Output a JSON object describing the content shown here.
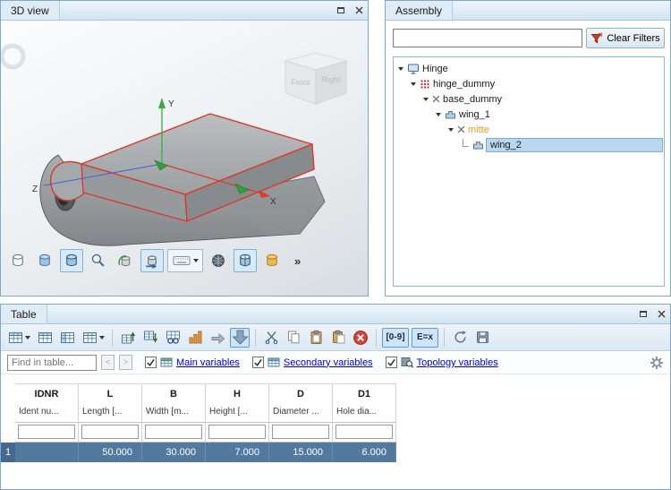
{
  "view3d": {
    "tab": "3D view",
    "axes": {
      "x": "X",
      "y": "Y",
      "z": "Z"
    },
    "cube": {
      "front": "Front",
      "right": "Right"
    },
    "toolbar_more": "»"
  },
  "assembly": {
    "tab": "Assembly",
    "filter_value": "",
    "clear_filters": "Clear Filters",
    "items": [
      {
        "label": "Hinge",
        "level": 0
      },
      {
        "label": "hinge_dummy",
        "level": 1
      },
      {
        "label": "base_dummy",
        "level": 2,
        "suppressed": true
      },
      {
        "label": "wing_1",
        "level": 3
      },
      {
        "label": "mitte",
        "level": 4,
        "suppressed": true,
        "highlighted": true
      },
      {
        "label": "wing_2",
        "level": 5,
        "selected": true
      }
    ]
  },
  "table": {
    "tab": "Table",
    "find_placeholder": "Find in table...",
    "prev": "<",
    "next": ">",
    "toggles": {
      "numeric": "[0-9]",
      "formula": "E=x"
    },
    "checkboxes": [
      {
        "label": "Main variables",
        "checked": true
      },
      {
        "label": "Secondary variables",
        "checked": true
      },
      {
        "label": "Topology variables",
        "checked": true
      }
    ],
    "columns": [
      {
        "code": "IDNR",
        "desc": "Ident nu...",
        "filter": ""
      },
      {
        "code": "L",
        "desc": "Length [...",
        "filter": ""
      },
      {
        "code": "B",
        "desc": "Width [m...",
        "filter": ""
      },
      {
        "code": "H",
        "desc": "Height [...",
        "filter": ""
      },
      {
        "code": "D",
        "desc": "Diameter ...",
        "filter": ""
      },
      {
        "code": "D1",
        "desc": "Hole dia...",
        "filter": ""
      }
    ],
    "rows": [
      {
        "num": "1",
        "cells": [
          "",
          "50.000",
          "30.000",
          "7.000",
          "15.000",
          "6.000"
        ],
        "selected": true
      }
    ]
  },
  "colors": {
    "accent": "#5f9bd0",
    "selected_row": "#537a9e",
    "row_header": "#44688e",
    "link_blue": "#0000cc",
    "mitte_orange": "#e8952e",
    "edge_red": "#d83a2c"
  }
}
